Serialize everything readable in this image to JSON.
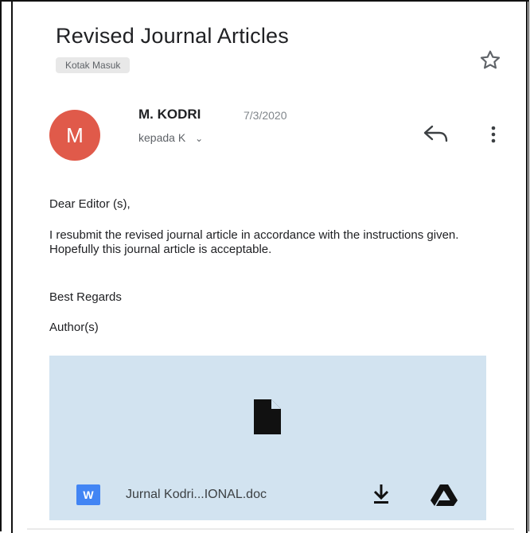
{
  "email": {
    "subject": "Revised Journal Articles",
    "label": "Kotak Masuk",
    "sender": {
      "initial": "M",
      "name": "M. KODRI",
      "date": "7/3/2020",
      "to": "kepada K"
    },
    "body": [
      "Dear Editor (s),",
      "I resubmit the revised journal article in accordance with the instructions given. Hopefully this journal article is acceptable.",
      "Best Regards",
      "Author(s)"
    ],
    "attachment": {
      "type_badge": "W",
      "filename": "Jurnal Kodri...IONAL.doc"
    }
  },
  "colors": {
    "avatar": "#e05a4a",
    "attachment_bg": "#d2e3f0",
    "word_blue": "#4285f4"
  },
  "icons": [
    "star-icon",
    "reply-icon",
    "more-vert-icon",
    "file-icon",
    "download-icon",
    "drive-icon",
    "chevron-down-icon"
  ]
}
